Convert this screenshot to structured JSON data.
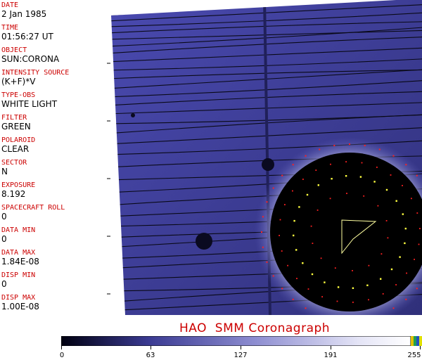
{
  "fields": [
    {
      "label": "DATE",
      "value": "2 Jan 1985"
    },
    {
      "label": "TIME",
      "value": "01:56:27 UT"
    },
    {
      "label": "OBJECT",
      "value": "SUN:CORONA"
    },
    {
      "label": "INTENSITY SOURCE",
      "value": "(K+F)*V"
    },
    {
      "label": "TYPE-OBS",
      "value": "WHITE LIGHT"
    },
    {
      "label": "FILTER",
      "value": "GREEN"
    },
    {
      "label": "POLAROID",
      "value": "CLEAR"
    },
    {
      "label": "SECTOR",
      "value": "N"
    },
    {
      "label": "EXPOSURE",
      "value": "8.192"
    },
    {
      "label": "SPACECRAFT ROLL",
      "value": "0"
    },
    {
      "label": "DATA MIN",
      "value": "0"
    },
    {
      "label": "DATA MAX",
      "value": "1.84E-08"
    },
    {
      "label": "DISP MIN",
      "value": "0"
    },
    {
      "label": "DISP MAX",
      "value": "1.00E-08"
    }
  ],
  "caption": "HAO  SMM Coronagraph",
  "colorbar": {
    "ticks": [
      "0",
      "63",
      "127",
      "191",
      "255"
    ],
    "colors": {
      "dark": "#0a0a3a",
      "mid": "#5a5ab8",
      "light": "#e8e8f8"
    }
  },
  "colors": {
    "label": "#cc0000",
    "field": "#3a3aa0",
    "occulter": "#000000",
    "marker_red": "#ff2020",
    "marker_yellow": "#ffff40"
  }
}
